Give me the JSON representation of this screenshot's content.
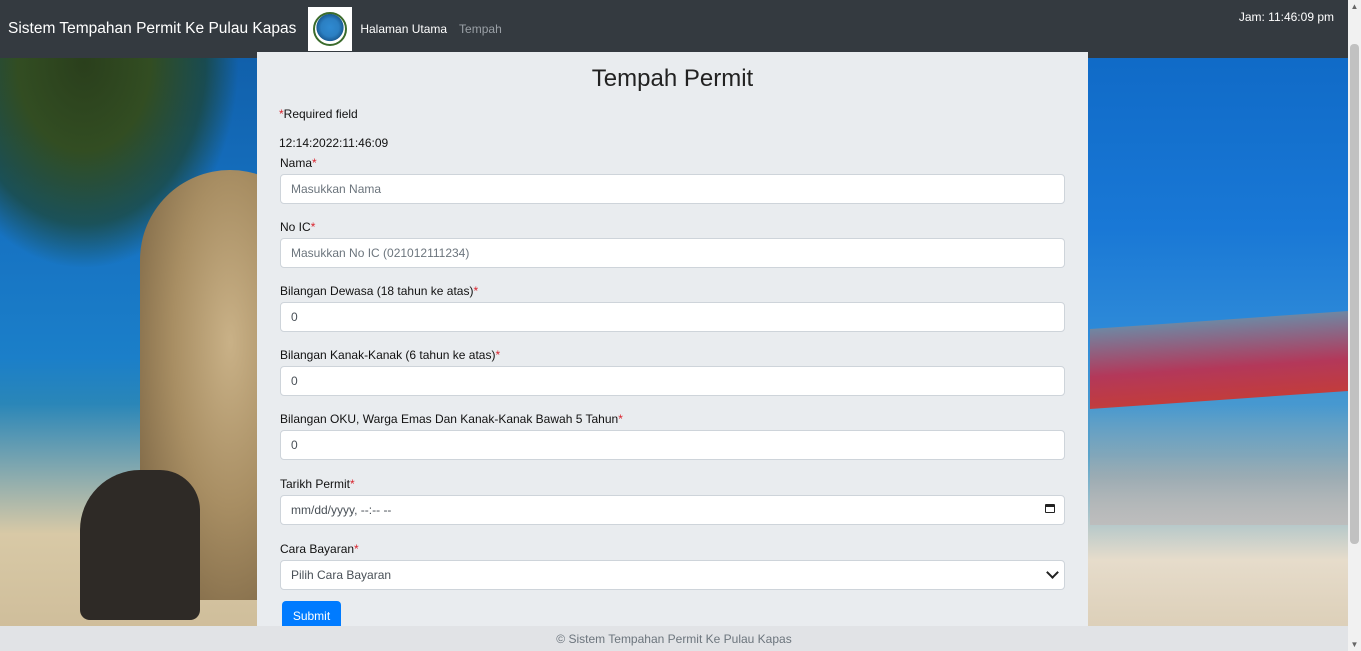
{
  "navbar": {
    "brand": "Sistem Tempahan Permit Ke Pulau Kapas",
    "links": [
      "Halaman Utama",
      "Tempah"
    ],
    "clock": "Jam: 11:46:09 pm"
  },
  "form": {
    "title": "Tempah Permit",
    "required_star": "*",
    "required_note": "Required field",
    "timestamp": "12:14:2022:11:46:09",
    "fields": [
      {
        "label": "Nama",
        "value": "",
        "placeholder": "Masukkan Nama"
      },
      {
        "label": "No IC",
        "value": "",
        "placeholder": "Masukkan No IC (021012111234)"
      },
      {
        "label": "Bilangan Dewasa (18 tahun ke atas)",
        "value": "0"
      },
      {
        "label": "Bilangan Kanak-Kanak (6 tahun ke atas)",
        "value": "0"
      },
      {
        "label": "Bilangan OKU, Warga Emas Dan Kanak-Kanak Bawah 5 Tahun",
        "value": "0"
      },
      {
        "label": "Tarikh Permit",
        "value": "mm/dd/yyyy, --:-- --",
        "icon": "calendar-icon"
      },
      {
        "label": "Cara Bayaran",
        "value": "Pilih Cara Bayaran",
        "icon": "chevron-down-icon"
      }
    ],
    "submit_label": "Submit"
  },
  "footer": {
    "text": "© Sistem Tempahan Permit Ke Pulau Kapas"
  },
  "colors": {
    "navbar": "#343a40",
    "panel": "#e9ecef",
    "required": "#d9232d",
    "primary": "#007bff"
  }
}
